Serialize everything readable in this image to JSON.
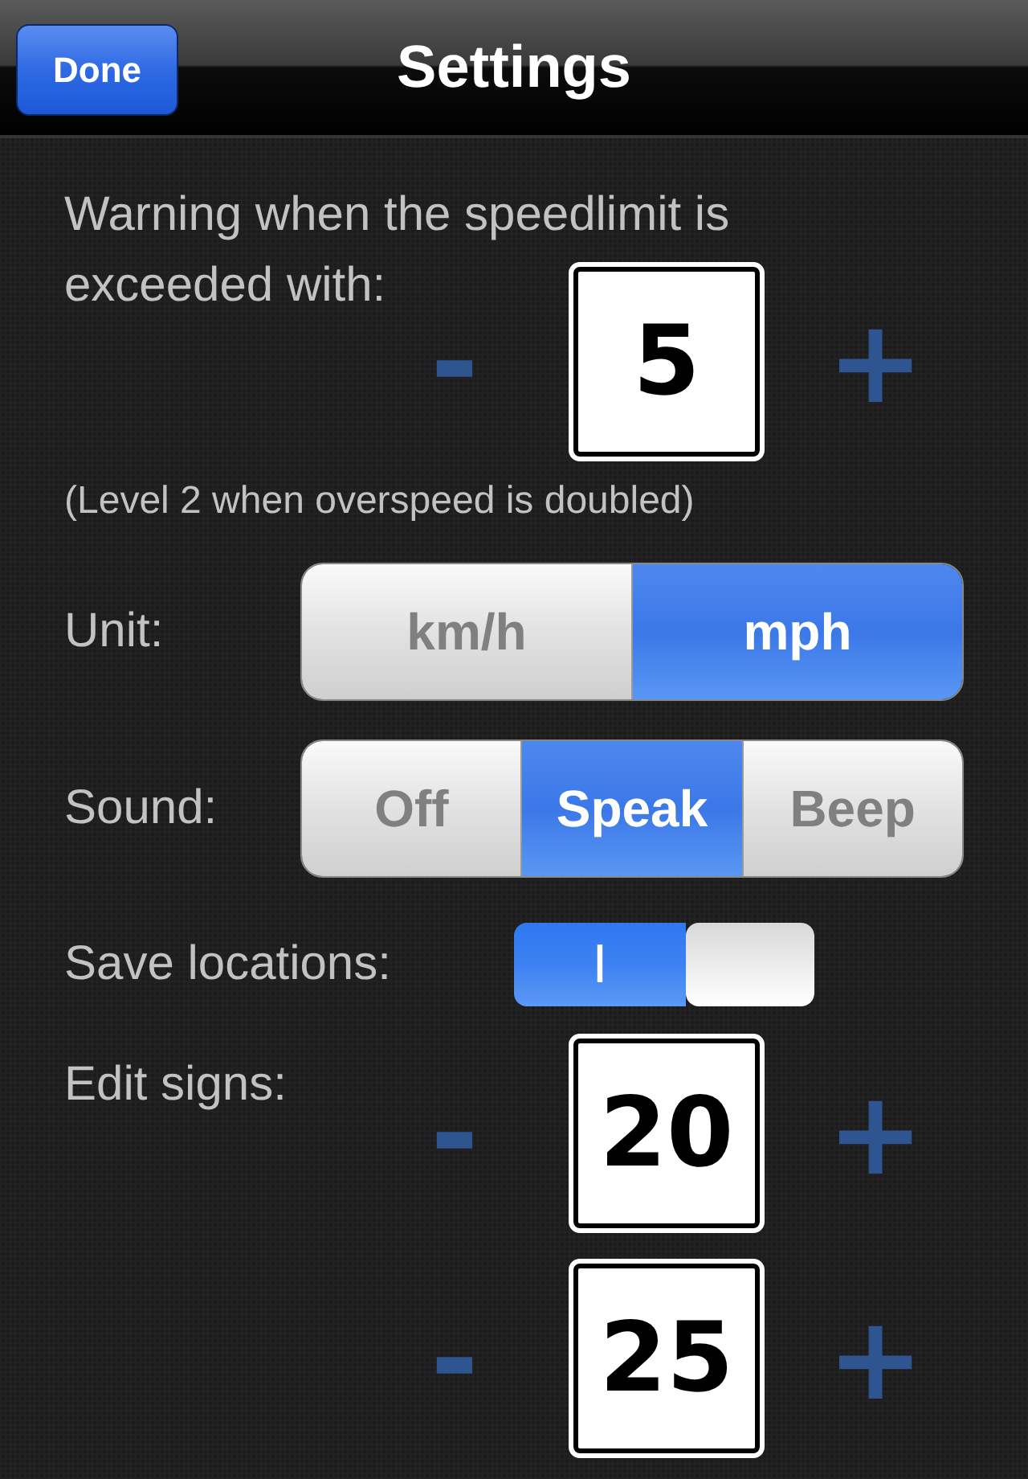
{
  "nav_bar": {
    "title": "Settings",
    "done_button": "Done"
  },
  "warning": {
    "label": "Warning when the speedlimit is exceeded with:",
    "stepper": {
      "minus": "-",
      "value": "5",
      "plus": "+"
    },
    "note": "(Level 2 when overspeed is doubled)"
  },
  "unit": {
    "label": "Unit:",
    "options": [
      {
        "label": "km/h",
        "selected": false
      },
      {
        "label": "mph",
        "selected": true
      }
    ]
  },
  "sound": {
    "label": "Sound:",
    "options": [
      {
        "label": "Off",
        "selected": false
      },
      {
        "label": "Speak",
        "selected": true
      },
      {
        "label": "Beep",
        "selected": false
      }
    ]
  },
  "save_locations": {
    "label": "Save locations:",
    "on": true,
    "on_text": "I"
  },
  "edit_signs": {
    "label": "Edit signs:",
    "steppers": [
      {
        "minus": "-",
        "value": "20",
        "plus": "+"
      },
      {
        "minus": "-",
        "value": "25",
        "plus": "+"
      }
    ]
  }
}
